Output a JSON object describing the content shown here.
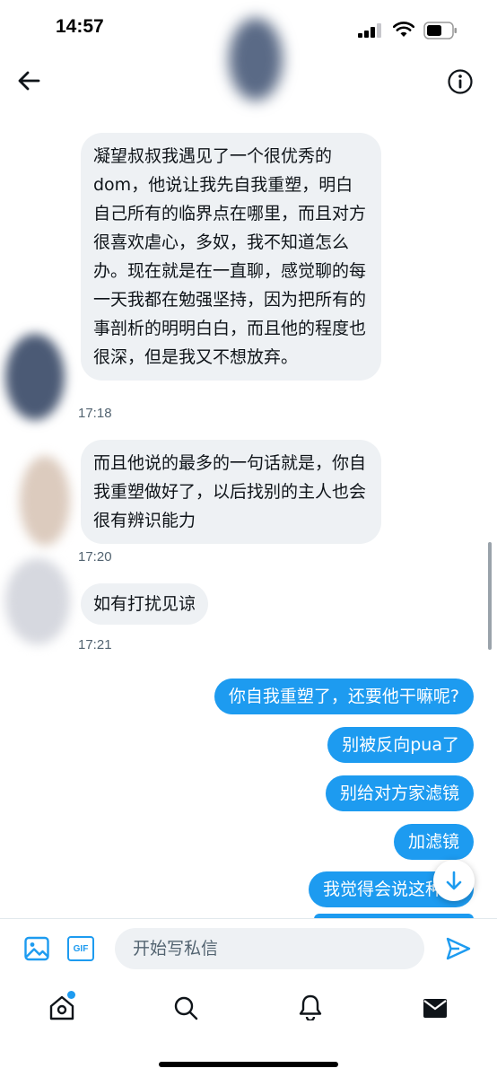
{
  "status_bar": {
    "time": "14:57"
  },
  "messages_in": [
    {
      "text": "凝望叔叔我遇见了一个很优秀的dom，他说让我先自我重塑，明白自己所有的临界点在哪里，而且对方很喜欢虐心，多奴，我不知道怎么办。现在就是在一直聊，感觉聊的每一天我都在勉强坚持，因为把所有的事剖析的明明白白，而且他的程度也很深，但是我又不想放弃。",
      "time": "17:18"
    },
    {
      "text": "而且他说的最多的一句话就是，你自我重塑做好了，以后找别的主人也会很有辨识能力",
      "time": "17:20"
    },
    {
      "text": "如有打扰见谅",
      "time": "17:21"
    }
  ],
  "messages_out": [
    "你自我重塑了，还要他干嘛呢?",
    "别被反向pua了",
    "别给对方家滤镜",
    "加滤镜",
    "我觉得会说这种话"
  ],
  "composer": {
    "placeholder": "开始写私信",
    "gif_label": "GIF"
  }
}
